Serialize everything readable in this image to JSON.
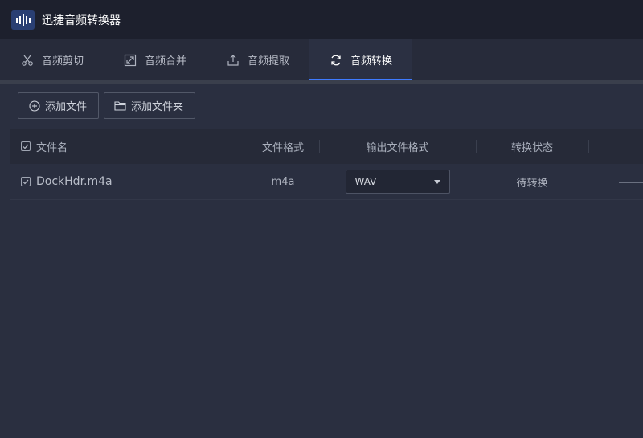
{
  "app": {
    "title": "迅捷音频转换器"
  },
  "tabs": [
    {
      "label": "音频剪切",
      "icon": "scissors-icon"
    },
    {
      "label": "音频合并",
      "icon": "merge-icon"
    },
    {
      "label": "音频提取",
      "icon": "extract-icon"
    },
    {
      "label": "音频转换",
      "icon": "refresh-icon",
      "active": true
    }
  ],
  "toolbar": {
    "add_file_label": "添加文件",
    "add_folder_label": "添加文件夹"
  },
  "table": {
    "columns": [
      "文件名",
      "文件格式",
      "输出文件格式",
      "转换状态"
    ],
    "rows": [
      {
        "name": "DockHdr.m4a",
        "format": "m4a",
        "output_format": "WAV",
        "status": "待转换",
        "checked": true
      }
    ]
  },
  "colors": {
    "accent": "#3f7bff",
    "background": "#2a2f40",
    "titlebar": "#1d202d"
  }
}
